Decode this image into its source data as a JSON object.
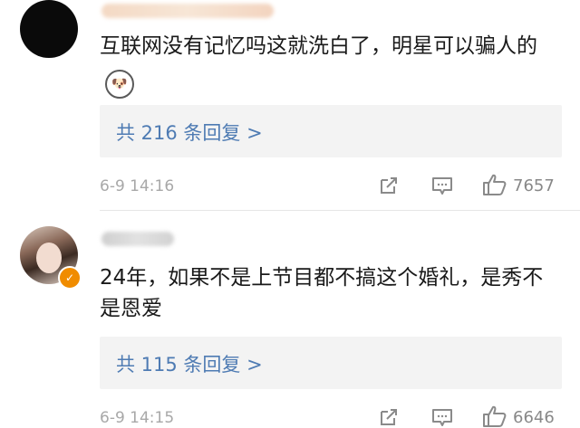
{
  "comments": [
    {
      "text": "互联网没有记忆吗这就洗白了，明星可以骗人的",
      "emoji": "dog-emoji",
      "replies_label": "共 216 条回复 >",
      "time": "6-9 14:16",
      "likes": "7657"
    },
    {
      "text": "24年，如果不是上节目都不搞这个婚礼，是秀不是恩爱",
      "replies_label": "共 115 条回复 >",
      "time": "6-9 14:15",
      "likes": "6646"
    }
  ],
  "icons": {
    "share": "share-icon",
    "reply": "comment-icon",
    "like": "thumbs-up-icon",
    "badge": "verified-badge-icon"
  },
  "colors": {
    "link": "#4e7bb3",
    "meta": "#a8a8a8",
    "reply_box": "#f3f3f3",
    "badge": "#f08c00"
  }
}
